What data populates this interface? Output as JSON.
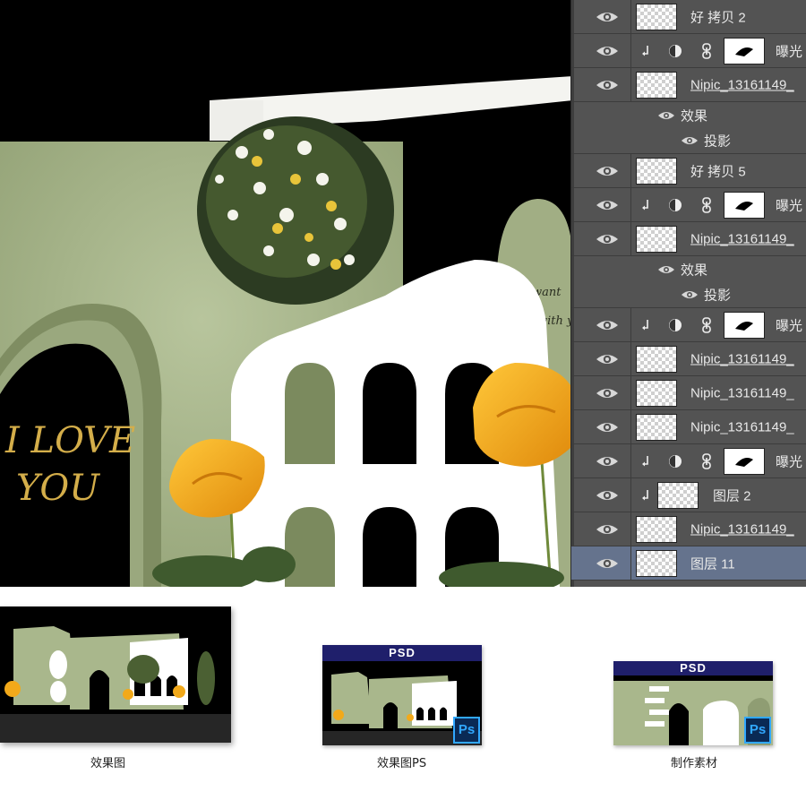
{
  "canvas": {
    "love_text_line1": "I LOVE",
    "love_text_line2": "YOU",
    "script_text": "want\nwith y\nn"
  },
  "layers_panel": {
    "rows": [
      {
        "kind": "layer",
        "name": "好 拷贝 2",
        "underlined": false
      },
      {
        "kind": "adjustment",
        "name": "曝光"
      },
      {
        "kind": "layer",
        "name": "Nipic_13161149_",
        "underlined": true
      },
      {
        "kind": "effects",
        "name": "效果"
      },
      {
        "kind": "effect",
        "name": "投影"
      },
      {
        "kind": "layer",
        "name": "好 拷贝 5",
        "underlined": false
      },
      {
        "kind": "adjustment",
        "name": "曝光"
      },
      {
        "kind": "layer",
        "name": "Nipic_13161149_",
        "underlined": true
      },
      {
        "kind": "effects",
        "name": "效果"
      },
      {
        "kind": "effect",
        "name": "投影"
      },
      {
        "kind": "adjustment",
        "name": "曝光"
      },
      {
        "kind": "layer",
        "name": "Nipic_13161149_",
        "underlined": true
      },
      {
        "kind": "layer",
        "name": "Nipic_13161149_",
        "underlined": false
      },
      {
        "kind": "layer",
        "name": "Nipic_13161149_",
        "underlined": false
      },
      {
        "kind": "adjustment",
        "name": "曝光"
      },
      {
        "kind": "clipped",
        "name": "图层 2"
      },
      {
        "kind": "layer",
        "name": "Nipic_13161149_",
        "underlined": true
      },
      {
        "kind": "layer",
        "name": "图层 11",
        "underlined": false,
        "selected": true
      }
    ]
  },
  "previews": [
    {
      "caption": "效果图"
    },
    {
      "caption": "效果图PS",
      "header": "PSD",
      "badge": "Ps"
    },
    {
      "caption": "制作素材",
      "header": "PSD",
      "badge": "Ps"
    }
  ],
  "colors": {
    "sage_green": "#a9b78c",
    "layers_panel_bg": "#535353",
    "selected_row": "#65738d",
    "psd_header": "#1f1f6b",
    "ps_blue": "#31a8ff",
    "flower_yellow": "#f2a91a"
  }
}
